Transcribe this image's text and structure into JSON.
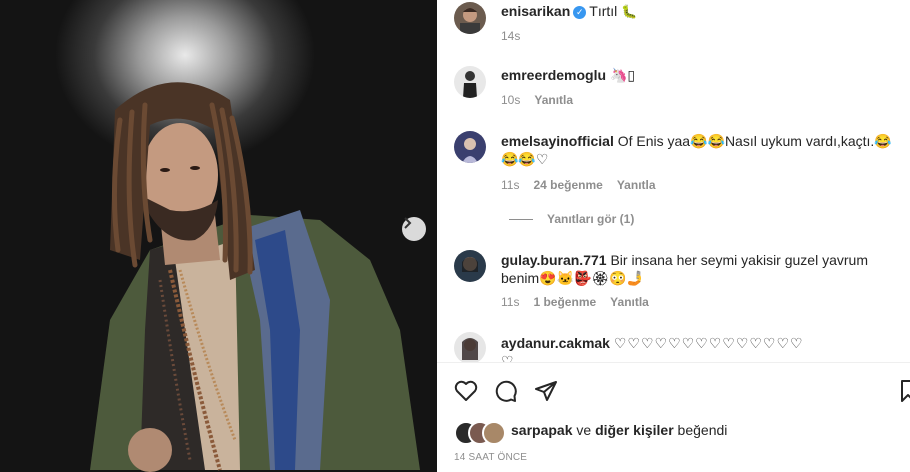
{
  "post": {
    "author": "enisarikan",
    "caption": "Tırtıl",
    "caption_emoji": "🐛",
    "age": "14s"
  },
  "comments": [
    {
      "user": "emreerdemoglu",
      "text": "🦄▯",
      "age": "10s",
      "reply": "Yanıtla"
    },
    {
      "user": "emelsayinofficial",
      "text_line1": "Of Enis yaa😂😂Nasıl uykum vardı,kaçtı.😂",
      "text_line2": "😂😂♡",
      "age": "11s",
      "likes": "24 beğenme",
      "reply": "Yanıtla",
      "view_replies": "Yanıtları gör (1)"
    },
    {
      "user": "gulay.buran.771",
      "text_line1": "Bir insana her seymi yakisir guzel yavrum",
      "text_line2": "benim😍🐱👺🏵😳🤳",
      "age": "11s",
      "likes": "1 beğenme",
      "reply": "Yanıtla"
    },
    {
      "user": "aydanur.cakmak",
      "text_line1": "♡♡♡♡♡♡♡♡♡♡♡♡♡♡",
      "text_line2": "♡"
    }
  ],
  "likes_summary": {
    "first": "sarpapak",
    "connector": "ve",
    "others": "diğer kişiler",
    "suffix": "beğendi"
  },
  "posted_time": "14 SAAT ÖNCE",
  "colors": {
    "verified": "#3897f0",
    "secondary_text": "#8e8e8e"
  }
}
